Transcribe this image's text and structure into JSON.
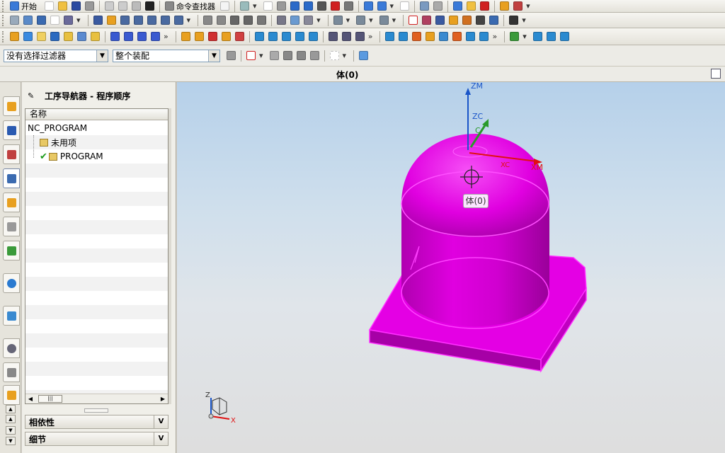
{
  "toolbar": {
    "start_label": "开始",
    "command_finder_label": "命令查找器",
    "selection_filter": {
      "value": "没有选择过滤器",
      "options": [
        "没有选择过滤器"
      ]
    },
    "assembly_scope": {
      "value": "整个装配",
      "options": [
        "整个装配"
      ]
    }
  },
  "graphics_window": {
    "title": "体(0)"
  },
  "navigator": {
    "title": "工序导航器 - 程序顺序",
    "column_header": "名称",
    "items": [
      {
        "label": "NC_PROGRAM",
        "level": 0
      },
      {
        "label": "未用项",
        "level": 1
      },
      {
        "label": "PROGRAM",
        "level": 1,
        "status": "complete"
      }
    ],
    "panels": [
      {
        "label": "相依性"
      },
      {
        "label": "细节"
      }
    ]
  },
  "viewport": {
    "tooltip": "体(0)",
    "wcs_labels": {
      "zm": "ZM",
      "zc": "ZC",
      "c": "C",
      "xc": "XC",
      "xm": "XM"
    },
    "triad_labels": {
      "z": "Z",
      "x": "X"
    },
    "colors": {
      "solid": "#e800e8",
      "solid_dark": "#8e008e",
      "axis_z": "#1a55c8",
      "axis_y": "#2a9a2a",
      "axis_x": "#e01010"
    }
  },
  "icons": [
    "start-icon",
    "save-icon",
    "undo-icon",
    "command-finder-icon",
    "snap-point-icon",
    "select-face-icon",
    "display-icon",
    "fit-view-icon",
    "zoom-icon",
    "orient-icon",
    "shaded-icon",
    "render-style-icon",
    "check-icon",
    "close-icon",
    "component-icon",
    "sketch-icon",
    "point-icon",
    "datum-icon",
    "extrude-icon",
    "analysis-icon",
    "pin-icon"
  ]
}
